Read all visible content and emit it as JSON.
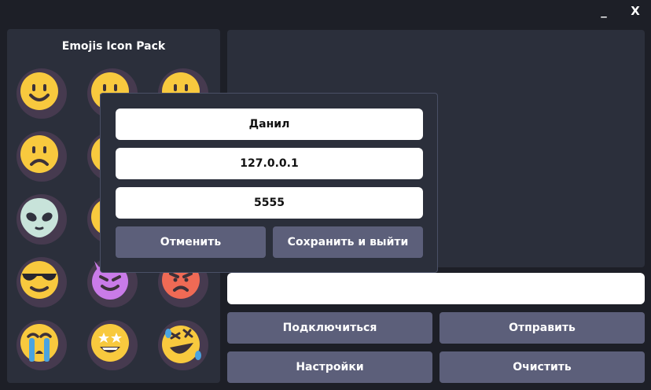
{
  "window": {
    "minimize_label": "_",
    "close_label": "X"
  },
  "emoji_panel": {
    "title": "Emojis Icon Pack",
    "icons": [
      {
        "name": "smiling-face-icon"
      },
      {
        "name": "smiling-face-icon"
      },
      {
        "name": "smiling-face-icon"
      },
      {
        "name": "sad-face-icon"
      },
      {
        "name": "sad-face-icon"
      },
      {
        "name": "sad-face-icon"
      },
      {
        "name": "alien-face-icon"
      },
      {
        "name": "smiling-face-icon"
      },
      {
        "name": "smiling-face-icon"
      },
      {
        "name": "sunglasses-face-icon"
      },
      {
        "name": "devil-face-icon"
      },
      {
        "name": "angry-face-icon"
      },
      {
        "name": "crying-face-icon"
      },
      {
        "name": "star-struck-face-icon"
      },
      {
        "name": "rolling-laughing-face-icon"
      }
    ]
  },
  "message_input": {
    "value": ""
  },
  "buttons": {
    "connect": "Подключиться",
    "send": "Отправить",
    "settings": "Настройки",
    "clear": "Очистить"
  },
  "settings_dialog": {
    "name_value": "Данил",
    "ip_value": "127.0.0.1",
    "port_value": "5555",
    "cancel": "Отменить",
    "save_exit": "Сохранить и выйти"
  },
  "colors": {
    "background": "#1d1f27",
    "panel": "#2b2f3b",
    "button": "#5c5f7a",
    "emoji_yellow": "#f8c93e",
    "emoji_shadow": "#463a4f"
  }
}
